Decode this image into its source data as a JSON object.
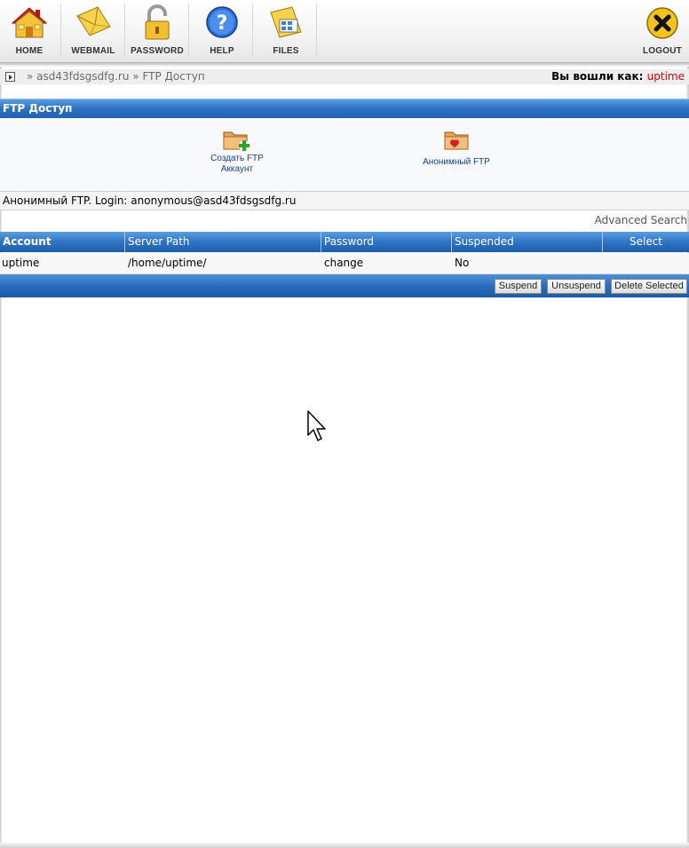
{
  "toolbar": {
    "home": "HOME",
    "webmail": "WEBMAIL",
    "password": "PASSWORD",
    "help": "HELP",
    "files": "FILES",
    "logout": "LOGOUT"
  },
  "breadcrumb": {
    "domain": "asd43fdsgsdfg.ru",
    "page": "FTP Доступ",
    "sep": "»"
  },
  "login": {
    "label": "Вы вошли как:",
    "user": "uptime"
  },
  "section": {
    "title": "FTP Доступ"
  },
  "actions": {
    "create_line1": "Создать FTP",
    "create_line2": "Аккаунт",
    "anon": "Анонимный FTP"
  },
  "info": "Анонимный FTP. Login: anonymous@asd43fdsgsdfg.ru",
  "advanced_search": "Advanced Search",
  "table": {
    "headers": [
      "Account",
      "Server Path",
      "Password",
      "Suspended",
      "Select"
    ],
    "rows": [
      [
        "uptime",
        "/home/uptime/",
        "change",
        "No",
        ""
      ]
    ]
  },
  "buttons": {
    "suspend": "Suspend",
    "unsuspend": "Unsuspend",
    "delete": "Delete Selected"
  },
  "icons": [
    "home-icon",
    "webmail-icon",
    "password-lock-icon",
    "help-icon",
    "files-icon",
    "logout-icon",
    "create-ftp-folder-icon",
    "anonymous-ftp-folder-icon",
    "mouse-cursor-icon"
  ]
}
